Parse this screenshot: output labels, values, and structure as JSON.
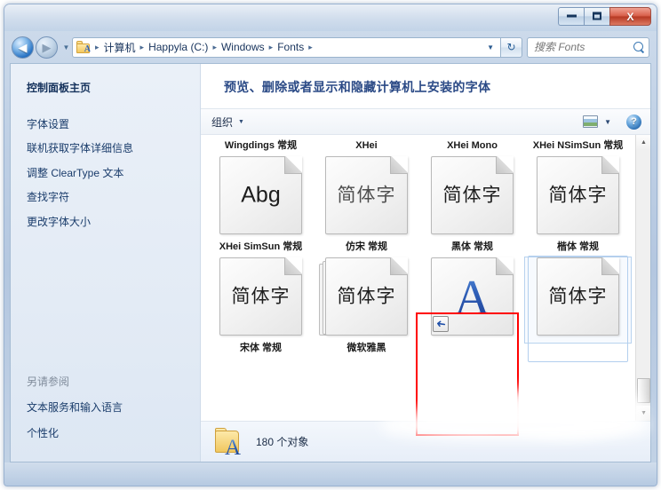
{
  "window": {
    "buttons": {
      "minimize": "–",
      "maximize": "□",
      "close": "X"
    }
  },
  "navigation": {
    "back_icon": "◀",
    "forward_icon": "▶",
    "history_caret": "▼",
    "refresh_icon": "↻",
    "address_caret": "▼",
    "folder_icon": "fonts-folder-icon",
    "breadcrumbs": [
      "计算机",
      "Happyla (C:)",
      "Windows",
      "Fonts"
    ],
    "separator": "▸"
  },
  "search": {
    "placeholder": "搜索 Fonts",
    "value": "",
    "icon": "search-icon"
  },
  "sidebar": {
    "home_label": "控制面板主页",
    "links": [
      "字体设置",
      "联机获取字体详细信息",
      "调整 ClearType 文本",
      "查找字符",
      "更改字体大小"
    ],
    "see_also_title": "另请参阅",
    "see_also_links": [
      "文本服务和输入语言",
      "个性化"
    ]
  },
  "main": {
    "page_title": "预览、删除或者显示和隐藏计算机上安装的字体",
    "toolbar": {
      "organize_label": "组织",
      "organize_caret": "▼",
      "view_icon": "view-options-icon",
      "view_caret": "▼",
      "help_label": "?"
    }
  },
  "fonts": {
    "rows": [
      [
        {
          "label": "Wingdings 常规",
          "preview": "Abg",
          "style": "latin",
          "tile": "single",
          "selected": false
        },
        {
          "label": "XHei",
          "preview": "简体字",
          "style": "thin",
          "tile": "single",
          "selected": false
        },
        {
          "label": "XHei Mono",
          "preview": "简体字",
          "style": "normal",
          "tile": "single",
          "selected": false
        },
        {
          "label": "XHei NSimSun 常规",
          "preview": "简体字",
          "style": "serifcn",
          "tile": "single",
          "selected": false
        }
      ],
      [
        {
          "label": "XHei SimSun 常规",
          "preview": "简体字",
          "style": "serifcn",
          "tile": "single",
          "selected": false
        },
        {
          "label": "仿宋 常规",
          "preview": "简体字",
          "style": "normal",
          "tile": "stack",
          "selected": false
        },
        {
          "label": "黑体 常规",
          "preview": "A",
          "style": "shortcut",
          "tile": "shortcut",
          "selected": false
        },
        {
          "label": "楷体 常规",
          "preview": "简体字",
          "style": "serifcn",
          "tile": "single",
          "selected": true
        }
      ],
      [
        {
          "label": "宋体 常规",
          "preview": "",
          "style": "normal",
          "tile": "single",
          "selected": false
        },
        {
          "label": "微软雅黑",
          "preview": "",
          "style": "normal",
          "tile": "single",
          "selected": false
        },
        {
          "label": "",
          "preview": "",
          "style": "normal",
          "tile": "single",
          "selected": false
        },
        {
          "label": "",
          "preview": "",
          "style": "normal",
          "tile": "single",
          "selected": false
        }
      ]
    ],
    "row2_labels": [
      "XHei SimSun 常规",
      "仿宋 常规",
      "黑体 常规",
      "楷体 常规"
    ],
    "row3_labels": [
      "宋体 常规",
      "微软雅黑",
      "",
      ""
    ]
  },
  "scrollbar": {
    "up_arrow": "▲",
    "down_arrow": "▼"
  },
  "status": {
    "count_text": "180 个对象",
    "folder_icon": "fonts-folder-icon",
    "folder_letter": "A"
  },
  "annotation": {
    "highlight_color": "#ff0000"
  }
}
